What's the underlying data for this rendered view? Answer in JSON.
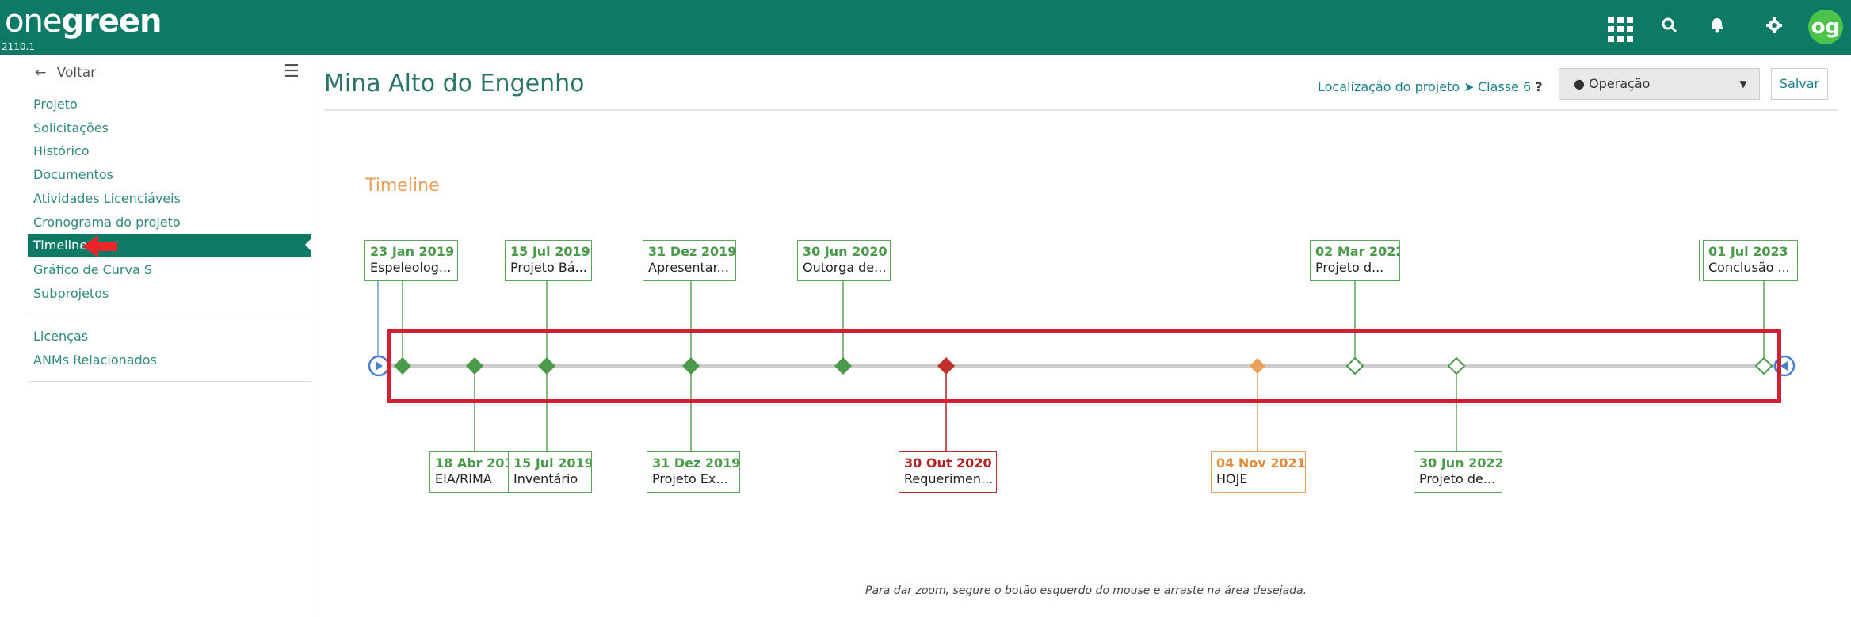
{
  "app": {
    "logo_light": "one",
    "logo_bold": "green",
    "version": "2110.1",
    "avatar_initials": "og"
  },
  "topbar_icons": [
    "apps-grid-icon",
    "search-icon",
    "bell-icon",
    "gear-icon"
  ],
  "sidebar": {
    "back_label": "Voltar",
    "items": [
      {
        "label": "Projeto"
      },
      {
        "label": "Solicitações"
      },
      {
        "label": "Histórico"
      },
      {
        "label": "Documentos"
      },
      {
        "label": "Atividades Licenciáveis"
      },
      {
        "label": "Cronograma do projeto"
      },
      {
        "label": "Timeline",
        "active": true
      },
      {
        "label": "Gráfico de Curva S"
      },
      {
        "label": "Subprojetos"
      }
    ],
    "secondary_items": [
      {
        "label": "Licenças"
      },
      {
        "label": "ANMs Relacionados"
      }
    ]
  },
  "header": {
    "title": "Mina Alto do Engenho",
    "location_link": "Localização do projeto",
    "classe_label": "Classe 6",
    "classe_help": "?",
    "status_select": "Operação",
    "save_label": "Salvar"
  },
  "timeline": {
    "title": "Timeline",
    "hint": "Para dar zoom, segure o botão esquerdo do mouse e arraste na área desejada.",
    "events_top": [
      {
        "date": "23 Jan 2019",
        "text": "Espeleolog..."
      },
      {
        "date": "15 Jul 2019",
        "text": "Projeto Bá..."
      },
      {
        "date": "31 Dez 2019",
        "text": "Apresentar..."
      },
      {
        "date": "30 Jun 2020",
        "text": "Outorga de..."
      },
      {
        "date": "02 Mar 2022",
        "text": "Projeto d..."
      },
      {
        "date": "01 Jul 2023",
        "text": "Conclusão ..."
      }
    ],
    "events_bottom": [
      {
        "date": "18 Abr 201",
        "text": "EIA/RIMA"
      },
      {
        "date": "15 Jul 2019",
        "text": "Inventário"
      },
      {
        "date": "31 Dez 2019",
        "text": "Projeto Ex..."
      },
      {
        "date": "30 Out 2020",
        "text": "Requerimen..."
      },
      {
        "date": "04 Nov 2021",
        "text": "HOJE"
      },
      {
        "date": "30 Jun 2022",
        "text": "Projeto de..."
      }
    ],
    "colors": {
      "done": "#4a9a4a",
      "late": "#b32222",
      "today": "#e8a05a",
      "pending": "#4a9a4a",
      "axis": "#cccccc",
      "nav_button": "#4a7fd0",
      "highlight": "#d32030"
    }
  }
}
